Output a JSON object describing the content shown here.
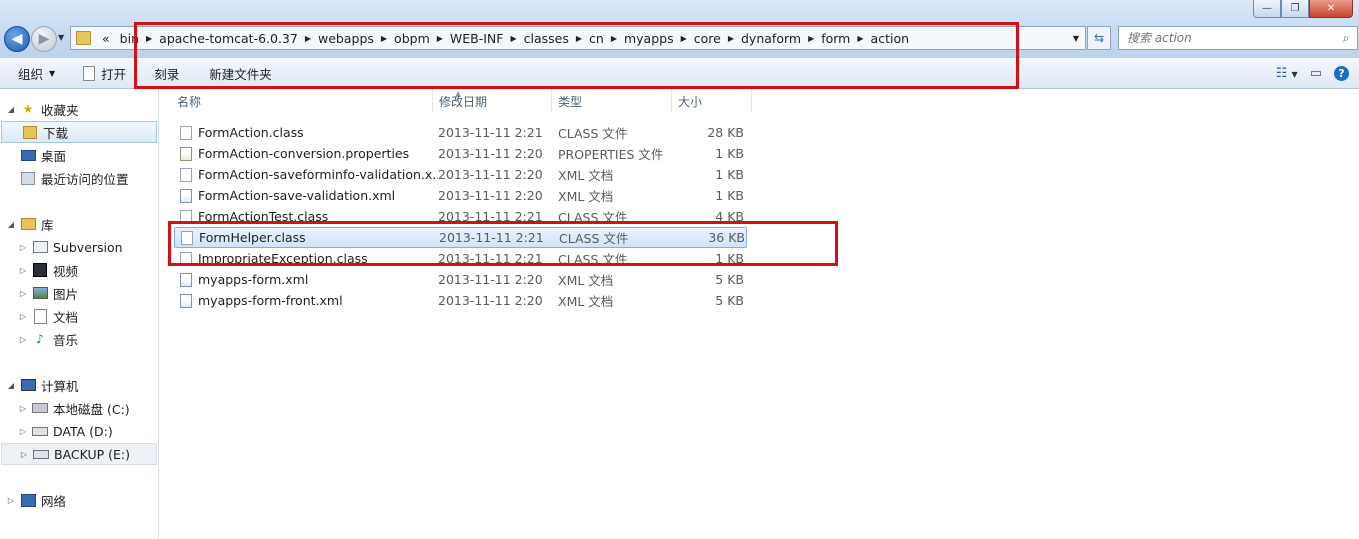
{
  "window": {
    "controls": [
      "—",
      "❐",
      "✕"
    ]
  },
  "nav": {
    "back_glyph": "◀",
    "forward_glyph": "▶"
  },
  "address": {
    "overflow": "«",
    "crumbs": [
      "bin",
      "apache-tomcat-6.0.37",
      "webapps",
      "obpm",
      "WEB-INF",
      "classes",
      "cn",
      "myapps",
      "core",
      "dynaform",
      "form",
      "action"
    ]
  },
  "search": {
    "placeholder": "搜索 action"
  },
  "toolbar": {
    "organize": "组织",
    "open": "打开",
    "burn": "刻录",
    "new_folder": "新建文件夹"
  },
  "sidebar": {
    "favorites": "收藏夹",
    "downloads": "下载",
    "desktop": "桌面",
    "recent": "最近访问的位置",
    "libraries": "库",
    "subversion": "Subversion",
    "videos": "视频",
    "pictures": "图片",
    "documents": "文档",
    "music": "音乐",
    "computer": "计算机",
    "drive_c": "本地磁盘 (C:)",
    "drive_d": "DATA (D:)",
    "drive_e": "BACKUP (E:)",
    "network": "网络"
  },
  "columns": {
    "name": "名称",
    "date": "修改日期",
    "type": "类型",
    "size": "大小"
  },
  "files": [
    {
      "name": "FormAction.class",
      "date": "2013-11-11 2:21",
      "type": "CLASS 文件",
      "size": "28 KB"
    },
    {
      "name": "FormAction-conversion.properties",
      "date": "2013-11-11 2:20",
      "type": "PROPERTIES 文件",
      "size": "1 KB"
    },
    {
      "name": "FormAction-saveforminfo-validation.x...",
      "date": "2013-11-11 2:20",
      "type": "XML 文档",
      "size": "1 KB"
    },
    {
      "name": "FormAction-save-validation.xml",
      "date": "2013-11-11 2:20",
      "type": "XML 文档",
      "size": "1 KB"
    },
    {
      "name": "FormActionTest.class",
      "date": "2013-11-11 2:21",
      "type": "CLASS 文件",
      "size": "4 KB"
    },
    {
      "name": "FormHelper.class",
      "date": "2013-11-11 2:21",
      "type": "CLASS 文件",
      "size": "36 KB"
    },
    {
      "name": "ImpropriateException.class",
      "date": "2013-11-11 2:21",
      "type": "CLASS 文件",
      "size": "1 KB"
    },
    {
      "name": "myapps-form.xml",
      "date": "2013-11-11 2:20",
      "type": "XML 文档",
      "size": "5 KB"
    },
    {
      "name": "myapps-form-front.xml",
      "date": "2013-11-11 2:20",
      "type": "XML 文档",
      "size": "5 KB"
    }
  ],
  "colors": {
    "annotation_red": "#d40f16",
    "selection_blue": "#cfe3fa"
  }
}
